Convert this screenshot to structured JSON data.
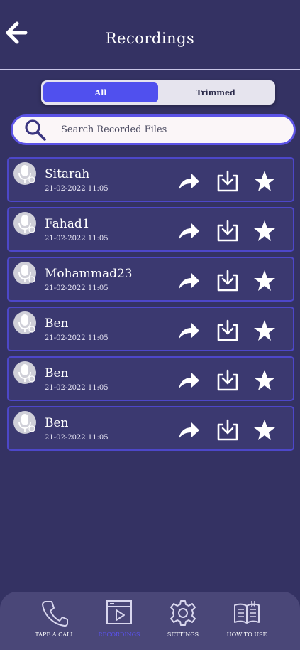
{
  "header": {
    "title": "Recordings",
    "back_icon": "arrow-left-icon"
  },
  "tabs": [
    {
      "label": "All",
      "active": true
    },
    {
      "label": "Trimmed",
      "active": false
    }
  ],
  "search": {
    "placeholder": "Search Recorded Files",
    "value": ""
  },
  "recordings": [
    {
      "name": "Sitarah",
      "date": "21-02-2022 11:05"
    },
    {
      "name": "Fahad1",
      "date": "21-02-2022 11:05"
    },
    {
      "name": "Mohammad23",
      "date": "21-02-2022 11:05"
    },
    {
      "name": "Ben",
      "date": "21-02-2022 11:05"
    },
    {
      "name": "Ben",
      "date": "21-02-2022 11:05"
    },
    {
      "name": "Ben",
      "date": "21-02-2022 11:05"
    }
  ],
  "nav": [
    {
      "label": "TAPE A CALL",
      "icon": "phone-icon",
      "active": false
    },
    {
      "label": "RECORDINGS",
      "icon": "video-player-icon",
      "active": true
    },
    {
      "label": "SETTINGS",
      "icon": "gear-icon",
      "active": false
    },
    {
      "label": "HOW TO USE",
      "icon": "book-icon",
      "active": false
    }
  ],
  "colors": {
    "background": "#343263",
    "accent": "#5050ee",
    "row_border": "#4d47c9"
  }
}
